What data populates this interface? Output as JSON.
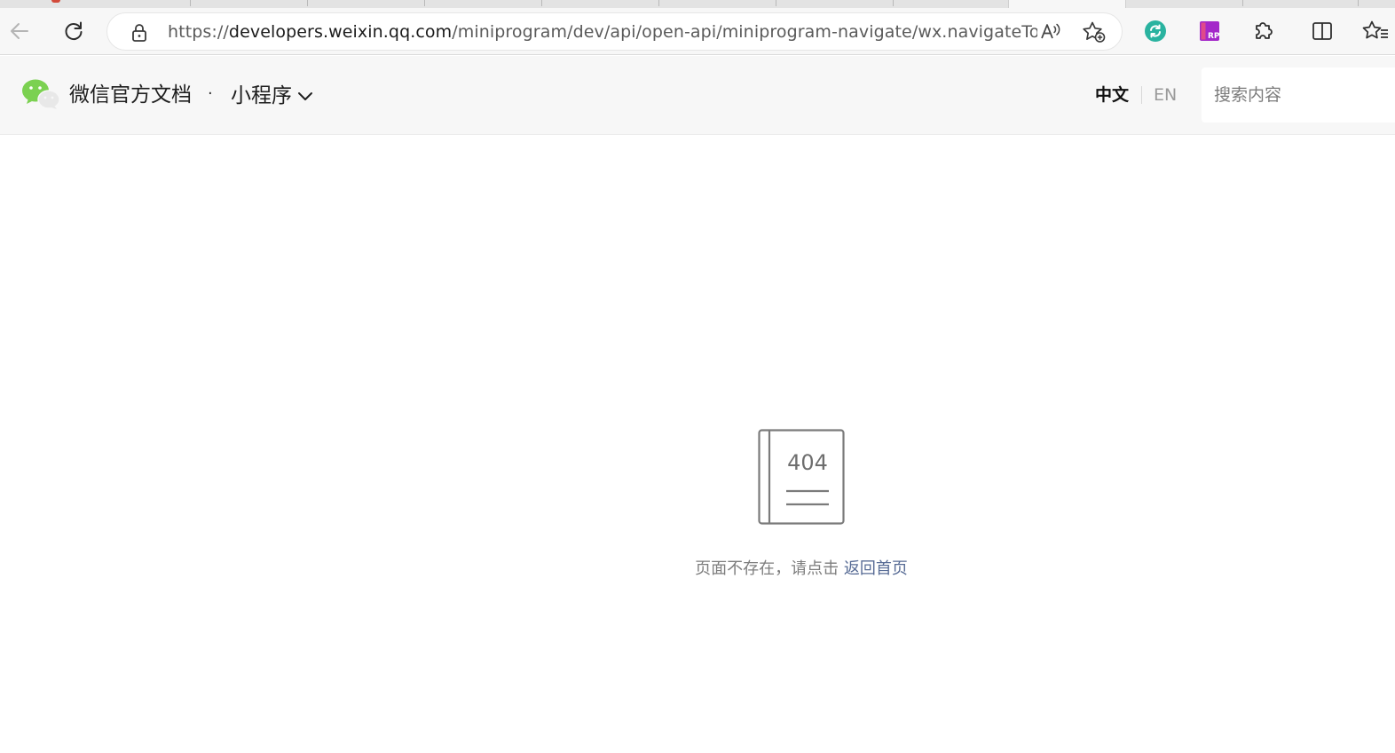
{
  "browser": {
    "url_scheme": "https://",
    "url_host": "developers.weixin.qq.com",
    "url_path": "/miniprogram/dev/api/open-api/miniprogram-navigate/wx.navigateToMiniProg..."
  },
  "header": {
    "brand": "微信官方文档",
    "separator": "·",
    "product": "小程序",
    "lang_zh": "中文",
    "lang_en": "EN",
    "search_placeholder": "搜索内容"
  },
  "error": {
    "code": "404",
    "message": "页面不存在，请点击 ",
    "home_link": "返回首页"
  },
  "colors": {
    "wechat_green": "#2aae67",
    "link": "#576b95",
    "icon_gray": "#7b7b7b"
  },
  "icons": [
    "back-arrow-icon",
    "refresh-icon",
    "lock-icon",
    "read-aloud-icon",
    "add-favorite-icon",
    "sync-extension-icon",
    "rp-extension-icon",
    "extensions-puzzle-icon",
    "split-screen-icon",
    "favorites-icon",
    "wechat-logo-icon",
    "chevron-down-icon",
    "book-404-icon"
  ]
}
